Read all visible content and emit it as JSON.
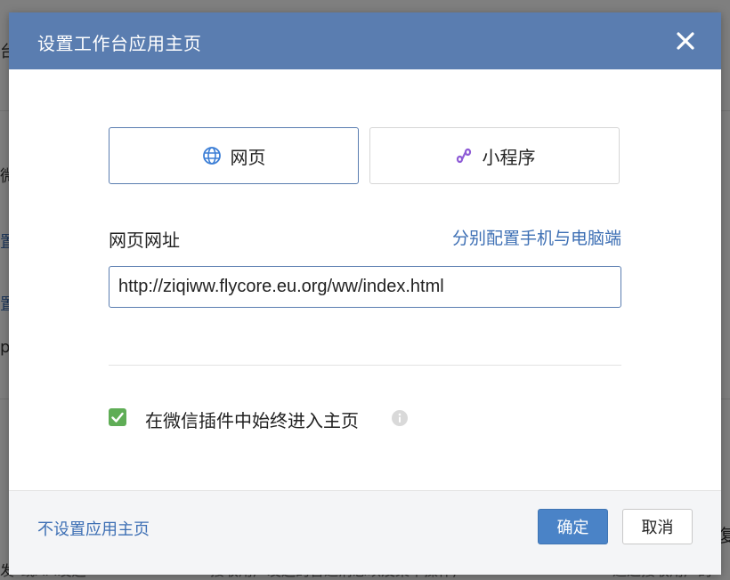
{
  "background": {
    "fragments": [
      "台",
      "微",
      "置",
      "置",
      "p:",
      "发\"或API发送",
      "接收用户发送的普通消息以及菜单操作,",
      "通过接收用户的",
      "复"
    ]
  },
  "dialog": {
    "title": "设置工作台应用主页",
    "close_icon": "close-icon",
    "tabs": [
      {
        "label": "网页",
        "icon": "globe-icon",
        "selected": true
      },
      {
        "label": "小程序",
        "icon": "miniprogram-icon",
        "selected": false
      }
    ],
    "field_label": "网页网址",
    "config_link": "分别配置手机与电脑端",
    "url_value": "http://ziqiww.flycore.eu.org/ww/index.html",
    "checkbox": {
      "checked": true,
      "label": "在微信插件中始终进入主页",
      "info_icon": "info-icon"
    },
    "footer": {
      "no_homepage_link": "不设置应用主页",
      "confirm_label": "确定",
      "cancel_label": "取消"
    }
  },
  "colors": {
    "header": "#5a7db0",
    "link": "#3d6fb4",
    "primary_button": "#4a83c7",
    "checkbox": "#5fad56",
    "miniprogram_icon": "#8e5bd6"
  }
}
